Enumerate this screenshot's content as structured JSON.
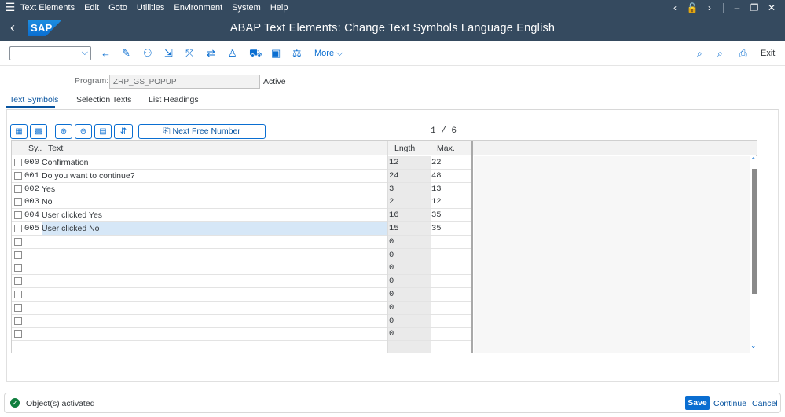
{
  "menu": [
    "Text Elements",
    "Edit",
    "Goto",
    "Utilities",
    "Environment",
    "System",
    "Help"
  ],
  "title": "ABAP Text Elements: Change Text Symbols Language English",
  "logo": "SAP",
  "toolbar": {
    "more": "More",
    "exit": "Exit"
  },
  "program": {
    "label": "Program:",
    "value": "ZRP_GS_POPUP",
    "status": "Active"
  },
  "tabs": [
    "Text Symbols",
    "Selection Texts",
    "List Headings"
  ],
  "next_free_number": "Next Free Number",
  "pager": "1 / 6",
  "columns": {
    "sym": "Sy..",
    "text": "Text",
    "length": "Lngth",
    "max": "Max."
  },
  "rows": [
    {
      "sym": "000",
      "text": "Confirmation",
      "len": "12",
      "max": "22"
    },
    {
      "sym": "001",
      "text": "Do you want to continue?",
      "len": "24",
      "max": "48"
    },
    {
      "sym": "002",
      "text": "Yes",
      "len": "3",
      "max": "13"
    },
    {
      "sym": "003",
      "text": "No",
      "len": "2",
      "max": "12"
    },
    {
      "sym": "004",
      "text": "User clicked Yes",
      "len": "16",
      "max": "35"
    },
    {
      "sym": "005",
      "text": "User clicked No",
      "len": "15",
      "max": "35"
    },
    {
      "sym": "",
      "text": "",
      "len": "0",
      "max": ""
    },
    {
      "sym": "",
      "text": "",
      "len": "0",
      "max": ""
    },
    {
      "sym": "",
      "text": "",
      "len": "0",
      "max": ""
    },
    {
      "sym": "",
      "text": "",
      "len": "0",
      "max": ""
    },
    {
      "sym": "",
      "text": "",
      "len": "0",
      "max": ""
    },
    {
      "sym": "",
      "text": "",
      "len": "0",
      "max": ""
    },
    {
      "sym": "",
      "text": "",
      "len": "0",
      "max": ""
    },
    {
      "sym": "",
      "text": "",
      "len": "0",
      "max": ""
    }
  ],
  "footer": {
    "message": "Object(s) activated",
    "save": "Save",
    "continue": "Continue",
    "cancel": "Cancel"
  }
}
